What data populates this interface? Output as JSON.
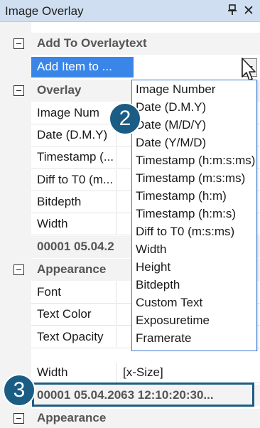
{
  "panel": {
    "title": "Image Overlay",
    "pin_glyph": "d",
    "close_glyph": "✕"
  },
  "categories": {
    "add_to_overlay": "Add To Overlaytext",
    "overlay": "Overlay",
    "appearance": "Appearance"
  },
  "add_item": {
    "value": "Add Item to ..."
  },
  "overlay_rows": [
    {
      "name": "Image Num"
    },
    {
      "name": "Date (D.M.Y)"
    },
    {
      "name": "Timestamp (..."
    },
    {
      "name": "Diff to T0 (m..."
    },
    {
      "name": "Bitdepth"
    },
    {
      "name": "Width"
    }
  ],
  "overlay_summary": "00001 05.04.2",
  "appearance_rows": [
    {
      "name": "Font"
    },
    {
      "name": "Text Color"
    },
    {
      "name": "Text Opacity"
    }
  ],
  "dropdown_options": [
    "Image Number",
    "Date (D.M.Y)",
    "Date (M/D/Y)",
    "Date (Y/M/D)",
    "Timestamp (h:m:s:ms)",
    "Timestamp (m:s:ms)",
    "Timestamp (h:m)",
    "Timestamp (h:m:s)",
    "Diff to T0 (m:s:ms)",
    "Width",
    "Height",
    "Bitdepth",
    "Custom Text",
    "Exposuretime",
    "Framerate"
  ],
  "lower": {
    "width_name": "Width",
    "width_value": "[x-Size]",
    "summary": "00001 05.04.2063 12:10:20:30...",
    "appearance": "Appearance"
  },
  "badges": {
    "step_2": "2",
    "step_3": "3"
  },
  "colors": {
    "title_bar": "#cfdef0",
    "selection": "#3a86e8",
    "dropdown_border": "#3e78c8",
    "badge": "#1b5c85"
  }
}
